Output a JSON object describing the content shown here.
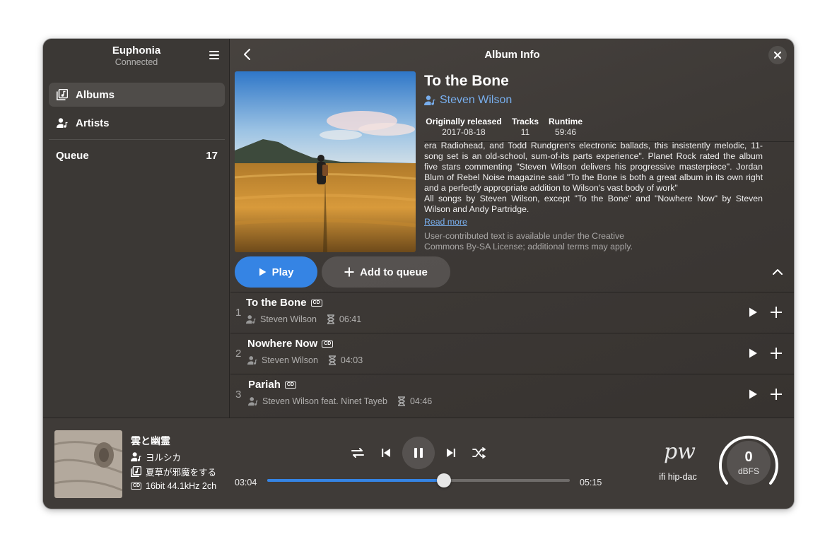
{
  "app": {
    "title": "Euphonia",
    "status": "Connected"
  },
  "sidebar": {
    "items": [
      {
        "label": "Albums",
        "icon": "albums-icon",
        "active": true
      },
      {
        "label": "Artists",
        "icon": "artist-icon",
        "active": false
      }
    ],
    "queue": {
      "label": "Queue",
      "count": "17"
    }
  },
  "header": {
    "title": "Album Info"
  },
  "album": {
    "title": "To the Bone",
    "artist": "Steven Wilson",
    "released_label": "Originally released",
    "released": "2017-08-18",
    "tracks_label": "Tracks",
    "tracks": "11",
    "runtime_label": "Runtime",
    "runtime": "59:46",
    "description": [
      "era Radiohead, and Todd Rundgren's electronic ballads, this insistently melodic, 11-song set is an old-school, sum-of-its parts experience\". Planet Rock rated the album five stars commenting \"Steven Wilson delivers his progressive masterpiece\". Jordan Blum of Rebel Noise magazine said \"To the Bone is both a great album in its own right and a perfectly appropriate addition to Wilson's vast body of work\"",
      "All songs by Steven Wilson, except \"To the Bone\" and \"Nowhere Now\" by Steven Wilson and Andy Partridge."
    ],
    "read_more": "Read more",
    "license": "User-contributed text is available under the Creative Commons By-SA License; additional terms may apply.",
    "play_label": "Play",
    "add_label": "Add to queue"
  },
  "tracks": [
    {
      "num": "1",
      "title": "To the Bone",
      "badge": "CD",
      "artist": "Steven Wilson",
      "duration": "06:41"
    },
    {
      "num": "2",
      "title": "Nowhere Now",
      "badge": "CD",
      "artist": "Steven Wilson",
      "duration": "04:03"
    },
    {
      "num": "3",
      "title": "Pariah",
      "badge": "CD",
      "artist": "Steven Wilson feat. Ninet Tayeb",
      "duration": "04:46"
    }
  ],
  "player": {
    "title": "雲と幽霊",
    "artist": "ヨルシカ",
    "album": "夏草が邪魔をする",
    "format_badge": "CD",
    "format": "16bit 44.1kHz 2ch",
    "elapsed": "03:04",
    "total": "05:15",
    "progress": 0.584,
    "output_logo": "pw",
    "output_device": "ifi hip-dac",
    "level_value": "0",
    "level_unit": "dBFS"
  },
  "colors": {
    "accent": "#3584e4",
    "link": "#78aeed"
  }
}
